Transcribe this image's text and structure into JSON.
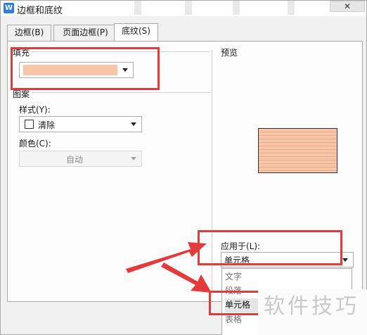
{
  "window": {
    "title": "边框和底纹",
    "app_icon_glyph": "W",
    "close_glyph": "✕"
  },
  "tabs": [
    {
      "label": "边框(B)",
      "active": false
    },
    {
      "label": "页面边框(P)",
      "active": false
    },
    {
      "label": "底纹(S)",
      "active": true
    }
  ],
  "fill": {
    "group_label": "填充",
    "color": "#f7c6a9"
  },
  "pattern": {
    "group_label": "图案",
    "style_label": "样式(Y):",
    "style_value": "清除",
    "color_label": "颜色(C):",
    "color_value": "自动"
  },
  "preview": {
    "label": "预览",
    "shading_color": "#f7c6a9"
  },
  "apply": {
    "label": "应用于(L):",
    "value": "单元格",
    "options": [
      "文字",
      "段落",
      "单元格",
      "表格"
    ],
    "selected": "单元格"
  },
  "annotation_color": "#e33b3b",
  "watermark": "软件技巧"
}
